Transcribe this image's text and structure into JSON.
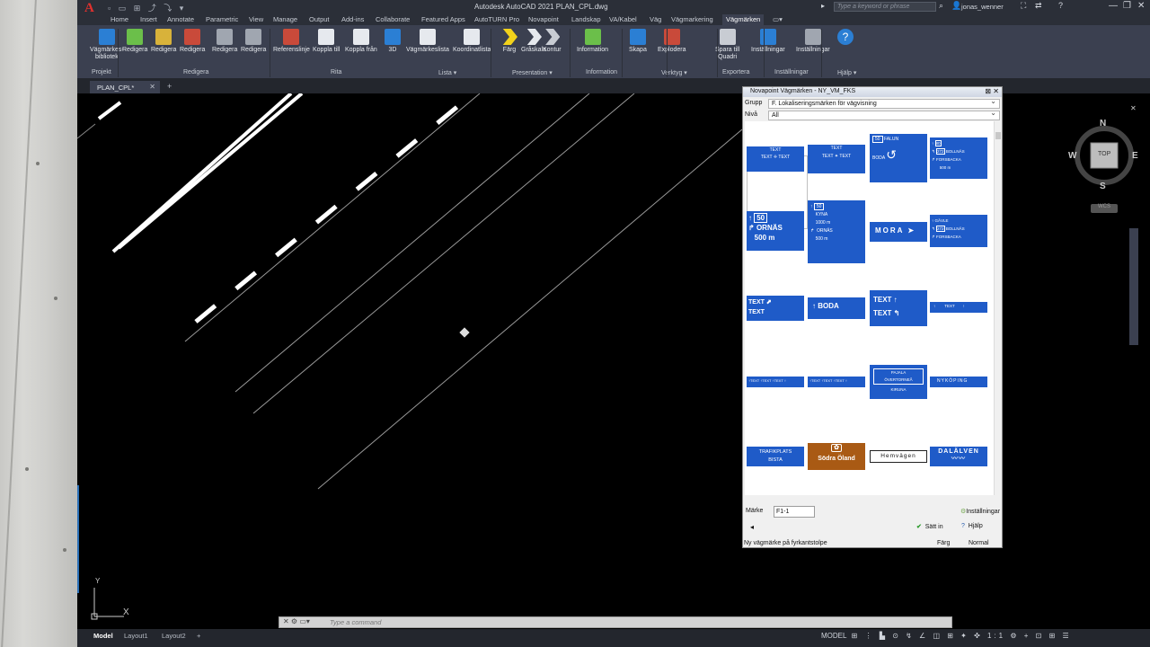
{
  "app": {
    "title": "Autodesk AutoCAD 2021   PLAN_CPL.dwg",
    "search_placeholder": "Type a keyword or phrase",
    "user": "jonas_wenner",
    "logo": "A"
  },
  "ribbon_tabs": [
    "Home",
    "Insert",
    "Annotate",
    "Parametric",
    "View",
    "Manage",
    "Output",
    "Add-ins",
    "Collaborate",
    "Featured Apps",
    "AutoTURN Pro",
    "Novapoint",
    "Landskap",
    "VA/Kabel",
    "Väg",
    "Vägmarkering",
    "Vägmärken"
  ],
  "active_tab": "Vägmärken",
  "ribbon_buttons": [
    {
      "label": "Vägmärkes-",
      "label2": "bibliotek",
      "icon": "sign-library-icon",
      "color": "#2b7fd4"
    },
    {
      "label": "Redigera",
      "label2": "",
      "icon": "edit-sign-icon",
      "color": "#6bbf4a"
    },
    {
      "label": "Redigera",
      "label2": "",
      "icon": "edit-sign-2-icon",
      "color": "#d8b23a"
    },
    {
      "label": "Redigera",
      "label2": "",
      "icon": "edit-sign-3-icon",
      "color": "#c94a3a"
    },
    {
      "label": "Redigera",
      "label2": "",
      "icon": "edit-3d-icon",
      "color": "#a0a6b0"
    },
    {
      "label": "Redigera",
      "label2": "",
      "icon": "edit-3d-2-icon",
      "color": "#a0a6b0"
    },
    {
      "label": "Referenslinje",
      "label2": "",
      "icon": "reference-line-icon",
      "color": "#c94a3a"
    },
    {
      "label": "Koppla till",
      "label2": "",
      "icon": "link-to-icon",
      "color": "#e6e9ee"
    },
    {
      "label": "Koppla från",
      "label2": "",
      "icon": "unlink-icon",
      "color": "#e6e9ee"
    },
    {
      "label": "3D",
      "label2": "",
      "icon": "3d-icon",
      "color": "#2b7fd4"
    },
    {
      "label": "Vägmärkeslista",
      "label2": "",
      "icon": "sign-list-icon",
      "color": "#e6e9ee"
    },
    {
      "label": "Koordinatlista",
      "label2": "",
      "icon": "coordinate-list-icon",
      "color": "#e6e9ee"
    },
    {
      "label": "Färg",
      "label2": "",
      "icon": "color-icon",
      "color": "#f2d21b"
    },
    {
      "label": "Gråskala",
      "label2": "",
      "icon": "grayscale-icon",
      "color": "#e6e9ee"
    },
    {
      "label": "Kontur",
      "label2": "",
      "icon": "contour-icon",
      "color": "#c8ccd3"
    },
    {
      "label": "Information",
      "label2": "",
      "icon": "information-icon",
      "color": "#6bbf4a"
    },
    {
      "label": "Skapa",
      "label2": "",
      "icon": "create-icon",
      "color": "#2b7fd4"
    },
    {
      "label": "Explodera",
      "label2": "",
      "icon": "explode-icon",
      "color": "#c94a3a"
    },
    {
      "label": "Spara till",
      "label2": "Quadri",
      "icon": "save-quadri-icon",
      "color": "#c8ccd3"
    },
    {
      "label": "Inställningar",
      "label2": "",
      "icon": "settings-grid-icon",
      "color": "#2b7fd4"
    },
    {
      "label": "Inställningar",
      "label2": "",
      "icon": "settings-tool-icon",
      "color": "#a0a6b0"
    },
    {
      "label": "",
      "label2": "",
      "icon": "help-icon",
      "color": "#2b7fd4"
    }
  ],
  "ribbon_panels": [
    "Projekt",
    "Redigera",
    "Rita",
    "Lista ▾",
    "Presentation ▾",
    "Information",
    "Verktyg ▾",
    "Exportera",
    "Inställningar",
    "Hjälp ▾"
  ],
  "doc_tab": "PLAN_CPL*",
  "viewcube": {
    "n": "N",
    "s": "S",
    "e": "E",
    "w": "W",
    "top": "TOP",
    "wcs": "WCS"
  },
  "palette": {
    "title": "Novapoint Vägmärken - NY_VM_FKS",
    "group_label": "Grupp",
    "group_value": "F. Lokaliseringsmärken för vägvisning",
    "level_label": "Nivå",
    "level_value": "All",
    "signs": {
      "text": "TEXT",
      "falun": "FALUN",
      "boda": "BODA",
      "fifty": "50",
      "gavle": "GÄVLE",
      "bollnas": "BOLLNÄS",
      "forsbacka": "FORSBACKA",
      "dist_500": "500 m",
      "r_eighty": "80",
      "r_272": "272",
      "ornas": "ORNÄS",
      "kyna": "KYNA",
      "dist_1000": "1000 m",
      "mora": "MORA",
      "pajala": "PAJALA",
      "overtornea": "ÖVERTORNEÅ",
      "kiruna": "KIRUNA",
      "nykoping": "NYKÖPING",
      "trafikplats": "TRAFIKPLATS",
      "bista": "BISTA",
      "sodra_oland": "Södra Öland",
      "hemvagen": "Hemvägen",
      "dalalven": "DALÄLVEN",
      "r_eighty_b": "80"
    },
    "marke_label": "Märke",
    "marke_value": "F1-1",
    "settings_label": "Inställningar",
    "insert_label": "Sätt in",
    "help_label": "Hjälp",
    "status_text": "Ny vägmärke på fyrkantstolpe",
    "color_label": "Färg",
    "mode_label": "Normal"
  },
  "command": {
    "placeholder": "Type  a  command"
  },
  "layouts": [
    "Model",
    "Layout1",
    "Layout2"
  ],
  "status_model": "MODEL",
  "ucs": {
    "x": "X",
    "y": "Y"
  }
}
